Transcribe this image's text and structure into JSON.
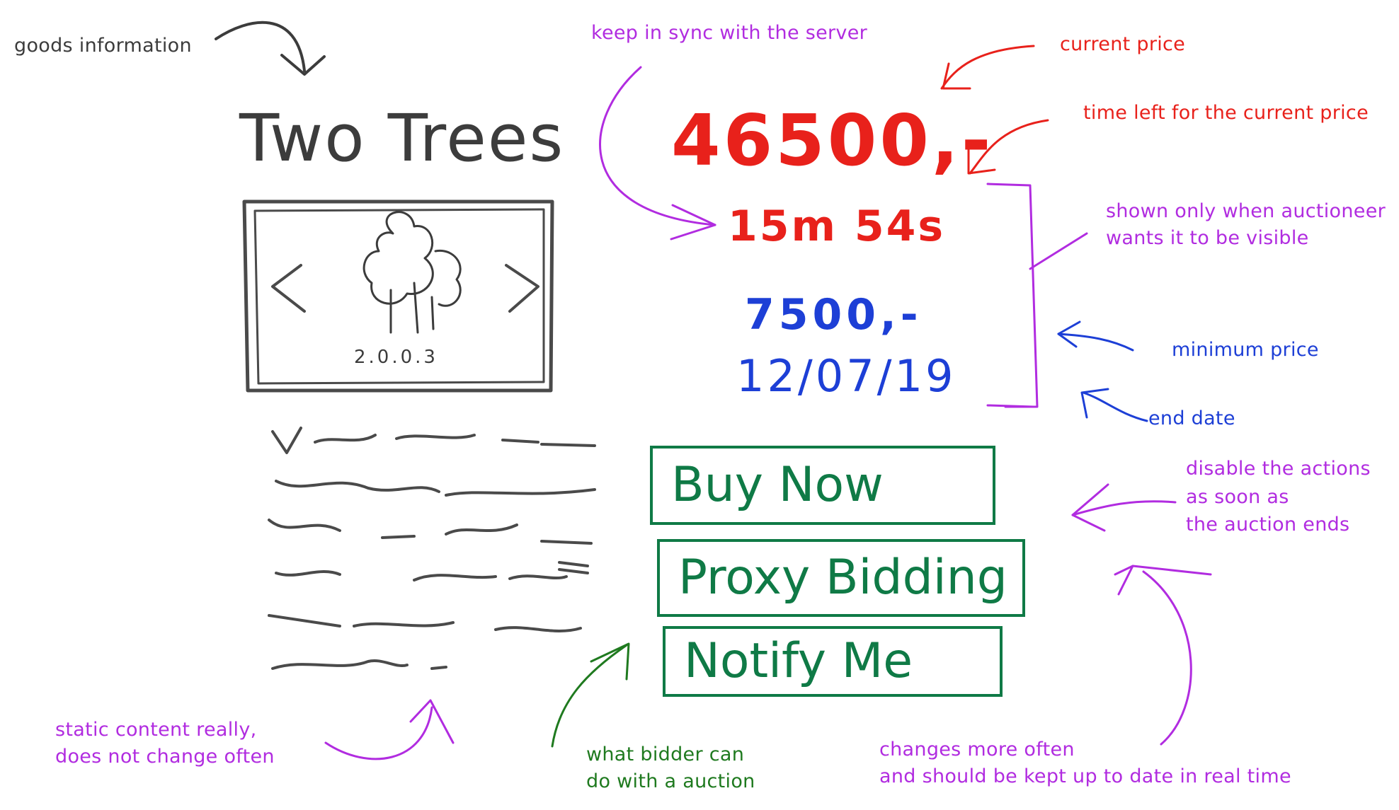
{
  "title": "Two Trees",
  "price": {
    "current": "46500,-",
    "time_left": "15m 54s",
    "minimum": "7500,-",
    "end_date": "12/07/19"
  },
  "image_caption": "2.0.0.3",
  "actions": {
    "buy_now": "Buy Now",
    "proxy_bidding": "Proxy Bidding",
    "notify_me": "Notify Me"
  },
  "annotations": {
    "goods_information": "goods information",
    "keep_in_sync": "keep in sync with the server",
    "current_price": "current price",
    "time_left": "time left for the current price",
    "shown_only_line1": "shown only when auctioneer",
    "shown_only_line2": "wants it to be visible",
    "minimum_price": "minimum price",
    "end_date": "end date",
    "disable_line1": "disable the actions",
    "disable_line2": "as soon as",
    "disable_line3": "the auction ends",
    "static_line1": "static content really,",
    "static_line2": "does not change often",
    "bidder_line1": "what bidder can",
    "bidder_line2": "do with a auction",
    "changes_line1": "changes more often",
    "changes_line2": "and should be kept up to date in real time"
  },
  "colors": {
    "gray": "#3c3c3c",
    "purple": "#b12ce0",
    "red": "#e8211b",
    "blue": "#1d3fd6",
    "green": "#1f7a1f",
    "button_green": "#0f7a46"
  }
}
